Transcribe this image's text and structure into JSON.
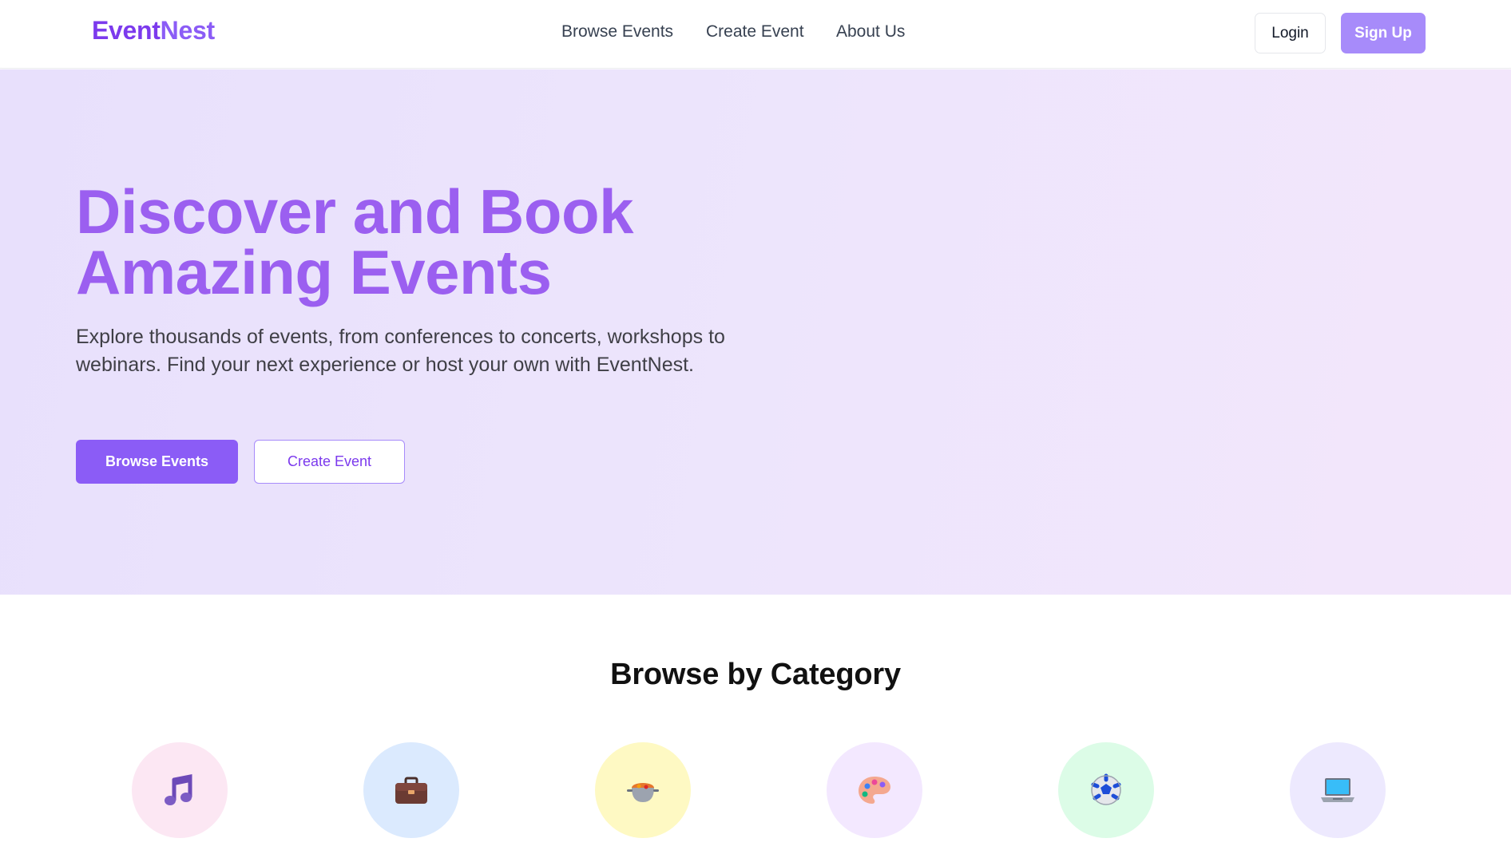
{
  "brand": {
    "name_part1": "Event",
    "name_part2": "Nest"
  },
  "nav": {
    "items": [
      {
        "label": "Browse Events"
      },
      {
        "label": "Create Event"
      },
      {
        "label": "About Us"
      }
    ]
  },
  "auth": {
    "login_label": "Login",
    "signup_label": "Sign Up"
  },
  "hero": {
    "title_line1": "Discover and Book",
    "title_line2": "Amazing Events",
    "description": "Explore thousands of events, from conferences to concerts, workshops to webinars. Find your next experience or host your own with EventNest.",
    "primary_button": "Browse Events",
    "secondary_button": "Create Event"
  },
  "categories": {
    "title": "Browse by Category",
    "items": [
      {
        "icon": "music-note-icon",
        "bg": "#fce7f3"
      },
      {
        "icon": "briefcase-icon",
        "bg": "#dbeafe"
      },
      {
        "icon": "food-bowl-icon",
        "bg": "#fef9c3"
      },
      {
        "icon": "palette-icon",
        "bg": "#f3e8ff"
      },
      {
        "icon": "soccer-ball-icon",
        "bg": "#dcfce7"
      },
      {
        "icon": "laptop-icon",
        "bg": "#ede9fe"
      }
    ]
  },
  "colors": {
    "brand": "#7c3aed",
    "accent": "#8b5cf6",
    "signup": "#a78bfa"
  }
}
